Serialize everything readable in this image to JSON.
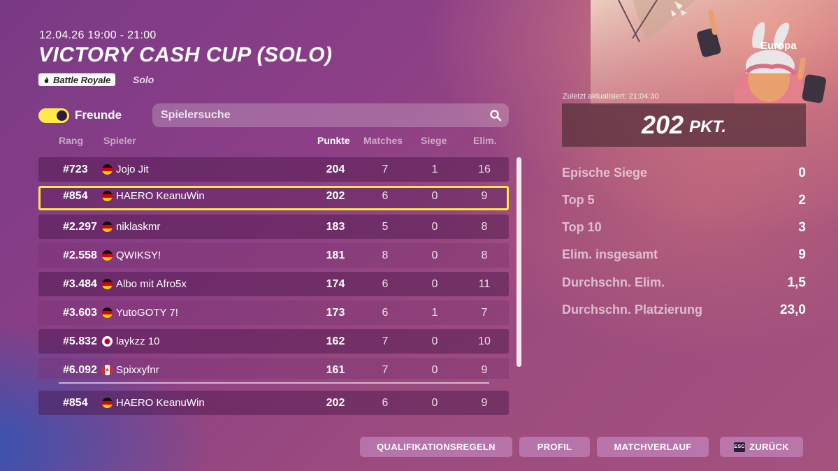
{
  "event": {
    "datetime": "12.04.26 19:00 - 21:00",
    "title": "VICTORY CASH CUP (SOLO)",
    "mode_badge": "Battle Royale",
    "mode_sub": "Solo"
  },
  "filters": {
    "friends_label": "Freunde",
    "friends_toggle_on": true,
    "search_placeholder": "Spielersuche"
  },
  "columns": {
    "rank": "Rang",
    "player": "Spieler",
    "points": "Punkte",
    "matches": "Matches",
    "wins": "Siege",
    "elims": "Elim."
  },
  "leaderboard": [
    {
      "rank": "#723",
      "flag": "germany-flag-icon",
      "name": "Jojo Jit",
      "points": "204",
      "matches": "7",
      "wins": "1",
      "elims": "16"
    },
    {
      "rank": "#854",
      "flag": "germany-flag-icon",
      "name": "HAERO KeanuWin",
      "points": "202",
      "matches": "6",
      "wins": "0",
      "elims": "9",
      "selected": true
    },
    {
      "rank": "#2.297",
      "flag": "germany-flag-icon",
      "name": "niklaskmr",
      "points": "183",
      "matches": "5",
      "wins": "0",
      "elims": "8"
    },
    {
      "rank": "#2.558",
      "flag": "germany-flag-icon",
      "name": "QWIKSY!",
      "points": "181",
      "matches": "8",
      "wins": "0",
      "elims": "8"
    },
    {
      "rank": "#3.484",
      "flag": "germany-flag-icon",
      "name": "Albo mit Afro5x",
      "points": "174",
      "matches": "6",
      "wins": "0",
      "elims": "11"
    },
    {
      "rank": "#3.603",
      "flag": "germany-flag-icon",
      "name": "YutoGOTY 7!",
      "points": "173",
      "matches": "6",
      "wins": "1",
      "elims": "7"
    },
    {
      "rank": "#5.832",
      "flag": "japan-flag-icon",
      "name": "laykzz 10",
      "points": "162",
      "matches": "7",
      "wins": "0",
      "elims": "10"
    },
    {
      "rank": "#6.092",
      "flag": "canada-flag-icon",
      "name": "Spixxyfnr",
      "points": "161",
      "matches": "7",
      "wins": "0",
      "elims": "9"
    }
  ],
  "my_row": {
    "rank": "#854",
    "flag": "germany-flag-icon",
    "name": "HAERO KeanuWin",
    "points": "202",
    "matches": "6",
    "wins": "0",
    "elims": "9"
  },
  "summary": {
    "region": "Europa",
    "updated": "Zuletzt aktualisiert: 21:04:30",
    "score": "202",
    "score_unit": "PKT.",
    "stats": [
      {
        "label": "Epische Siege",
        "value": "0"
      },
      {
        "label": "Top 5",
        "value": "2"
      },
      {
        "label": "Top 10",
        "value": "3"
      },
      {
        "label": "Elim. insgesamt",
        "value": "9"
      },
      {
        "label": "Durchschn. Elim.",
        "value": "1,5"
      },
      {
        "label": "Durchschn. Platzierung",
        "value": "23,0"
      }
    ]
  },
  "footer": {
    "rules": "QUALIFIKATIONSREGELN",
    "profile": "PROFIL",
    "match_history": "MATCHVERLAUF",
    "back": "ZURÜCK",
    "esc_key": "ESC"
  },
  "colors": {
    "highlight": "#fde84a",
    "toggle_on": "#ffe94a"
  }
}
